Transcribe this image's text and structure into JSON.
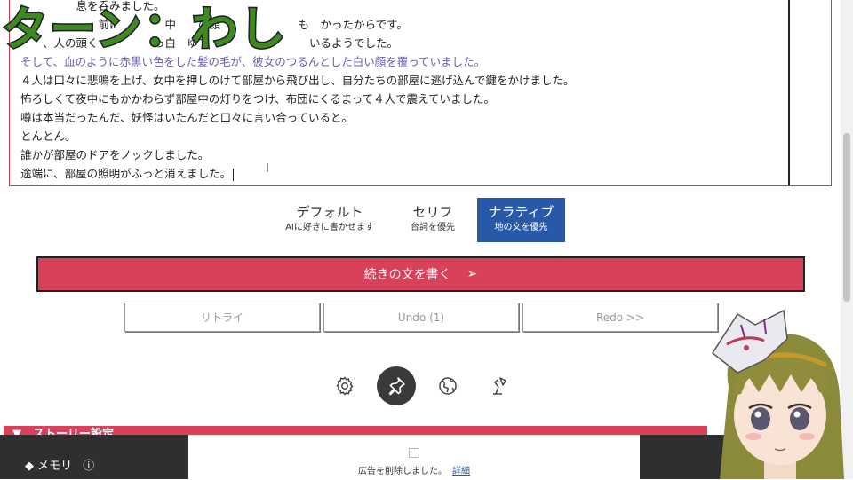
{
  "overlay": {
    "title": "ターン：わし"
  },
  "editor": {
    "lines": [
      {
        "text": "　　　　　息を呑みました。",
        "style": "normal"
      },
      {
        "text": "　　　　　　　前に　　　　中　　の顔　　　　　　　も　かったからです。",
        "style": "normal"
      },
      {
        "text": "　　、人の頭く　　　　　っ白　ゆて　　　　　　　　　いるようでした。",
        "style": "normal"
      },
      {
        "text": "そして、血のように赤黒い色をした髪の毛が、彼女のつるんとした白い顔を覆っていました。",
        "style": "blue"
      },
      {
        "text": "４人は口々に悲鳴を上げ、女中を押しのけて部屋から飛び出し、自分たちの部屋に逃げ込んで鍵をかけました。",
        "style": "normal"
      },
      {
        "text": "怖ろしくて夜中にもかかわらず部屋中の灯りをつけ、布団にくるまって４人で震えていました。",
        "style": "normal"
      },
      {
        "text": "噂は本当だったんだ、妖怪はいたんだと口々に言い合っていると。",
        "style": "normal"
      },
      {
        "text": "とんとん。",
        "style": "normal"
      },
      {
        "text": "誰かが部屋のドアをノックしました。",
        "style": "normal"
      },
      {
        "text": "途端に、部屋の照明がふっと消えました。",
        "style": "normal"
      }
    ]
  },
  "modes": [
    {
      "title": "デフォルト",
      "sub": "AIに好きに書かせます",
      "active": false
    },
    {
      "title": "セリフ",
      "sub": "台詞を優先",
      "active": false
    },
    {
      "title": "ナラティブ",
      "sub": "地の文を優先",
      "active": true
    }
  ],
  "actions": {
    "write_label": "続きの文を書く",
    "write_arrow": "➢",
    "retry_label": "リトライ",
    "undo_label": "Undo (1)",
    "redo_label": "Redo >>"
  },
  "toolbar_icons": [
    "gear-icon",
    "pin-icon",
    "globe-icon",
    "lamp-icon"
  ],
  "story": {
    "label": "▼　ストーリー設定"
  },
  "memo": {
    "label": "◆ メモリ",
    "info_icon": "ⓘ"
  },
  "ad": {
    "text": "広告を削除しました。",
    "link": "詳細"
  },
  "colors": {
    "accent": "#d9405a",
    "active_mode": "#2858a8",
    "overlay_text": "#3d8a1f"
  }
}
